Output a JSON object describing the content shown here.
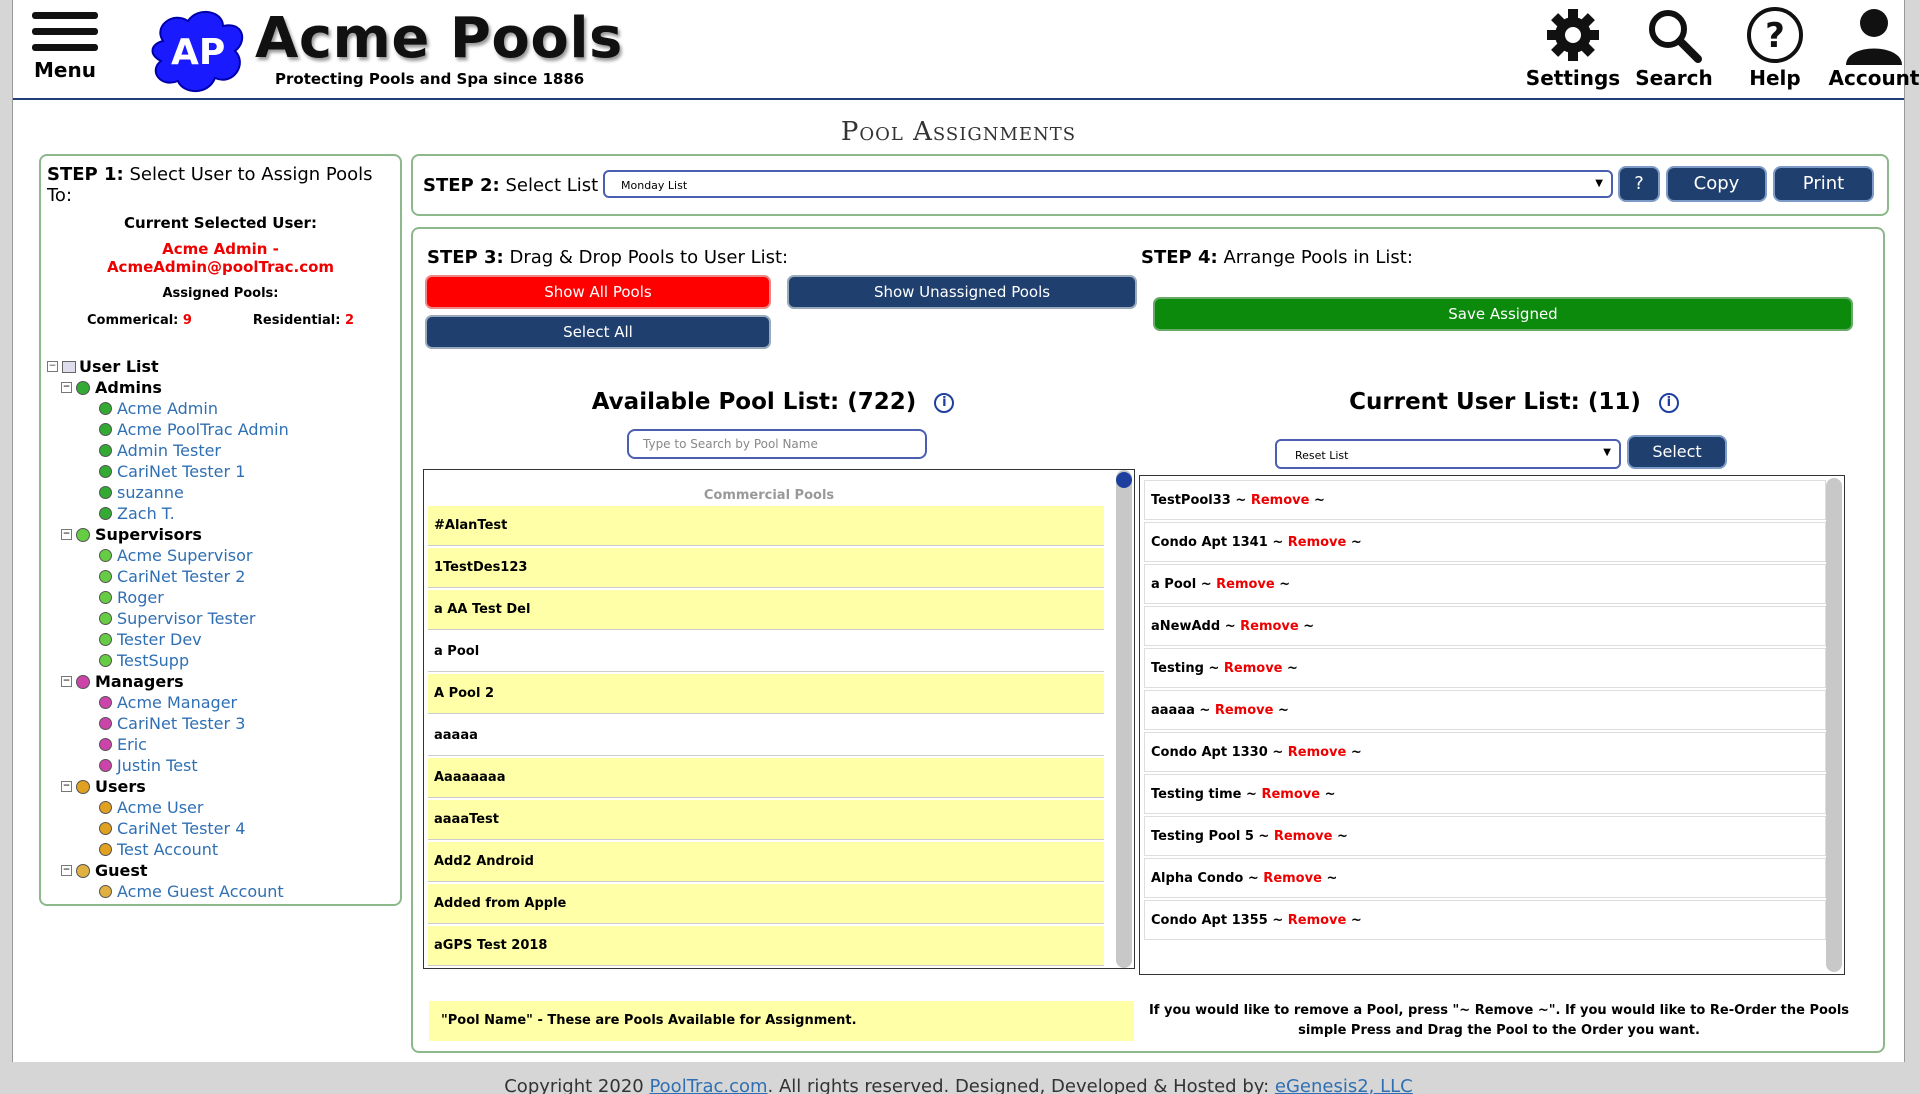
{
  "header": {
    "menu_label": "Menu",
    "logo_initials": "AP",
    "brand": "Acme Pools",
    "tagline": "Protecting Pools and Spa since 1886",
    "settings_label": "Settings",
    "search_label": "Search",
    "help_label": "Help",
    "account_label": "Account"
  },
  "page_title": "Pool Assignments",
  "step1": {
    "step": "STEP 1:",
    "text": "Select User to Assign Pools To:",
    "current_label": "Current Selected User:",
    "current_user": "Acme Admin - AcmeAdmin@poolTrac.com",
    "assigned_label": "Assigned Pools:",
    "commercial_label": "Commerical:",
    "commercial_count": "9",
    "residential_label": "Residential:",
    "residential_count": "2",
    "tree_root": "User List",
    "groups": [
      {
        "name": "Admins",
        "color": "#33aa33",
        "users": [
          "Acme Admin",
          "Acme PoolTrac Admin",
          "Admin Tester",
          "CariNet Tester 1",
          "suzanne",
          "Zach T."
        ]
      },
      {
        "name": "Supervisors",
        "color": "#66cc44",
        "users": [
          "Acme Supervisor",
          "CariNet Tester 2",
          "Roger",
          "Supervisor Tester",
          "Tester Dev",
          "TestSupp"
        ]
      },
      {
        "name": "Managers",
        "color": "#cc44aa",
        "users": [
          "Acme Manager",
          "CariNet Tester 3",
          "Eric",
          "Justin Test"
        ]
      },
      {
        "name": "Users",
        "color": "#e0a020",
        "users": [
          "Acme User",
          "CariNet Tester 4",
          "Test Account"
        ]
      },
      {
        "name": "Guest",
        "color": "#e0b040",
        "users": [
          "Acme Guest Account"
        ]
      }
    ]
  },
  "step2": {
    "step": "STEP 2:",
    "text": "Select List",
    "selected_list": "Monday List",
    "help_btn": "?",
    "copy_btn": "Copy",
    "print_btn": "Print"
  },
  "step3": {
    "step": "STEP 3:",
    "text": "Drag & Drop Pools to User List:",
    "show_all": "Show All Pools",
    "show_unassigned": "Show Unassigned Pools",
    "select_all": "Select All"
  },
  "step4": {
    "step": "STEP 4:",
    "text": "Arrange Pools in List:",
    "save": "Save Assigned"
  },
  "available": {
    "title": "Available Pool List:",
    "count": "(722)",
    "search_placeholder": "Type to Search by Pool Name",
    "category": "Commercial Pools",
    "pools": [
      {
        "name": "#AlanTest",
        "assigned": false
      },
      {
        "name": "1TestDes123",
        "assigned": false
      },
      {
        "name": "a AA Test Del",
        "assigned": false
      },
      {
        "name": "a Pool",
        "assigned": true
      },
      {
        "name": "A Pool 2",
        "assigned": false
      },
      {
        "name": "aaaaa",
        "assigned": true
      },
      {
        "name": "Aaaaaaaa",
        "assigned": false
      },
      {
        "name": "aaaaTest",
        "assigned": false
      },
      {
        "name": "Add2 Android",
        "assigned": false
      },
      {
        "name": "Added from Apple",
        "assigned": false
      },
      {
        "name": "aGPS Test 2018",
        "assigned": false
      }
    ],
    "note": "\"Pool Name\" - These are Pools Available for Assignment."
  },
  "current": {
    "title": "Current User List:",
    "count": "(11)",
    "reset_option": "Reset List",
    "select_btn": "Select",
    "remove_label": "~ Remove ~",
    "pools": [
      "TestPool33",
      "Condo Apt 1341",
      "a Pool",
      "aNewAdd",
      "Testing",
      "aaaaa",
      "Condo Apt 1330",
      "Testing time",
      "Testing Pool 5",
      "Alpha Condo",
      "Condo Apt 1355"
    ],
    "note": "If you would like to remove a Pool, press \"~ Remove ~\". If you would like to Re-Order the Pools simple Press and Drag the Pool to the Order you want."
  },
  "footer": {
    "prefix": "Copyright 2020",
    "link1": "PoolTrac.com",
    "middle": ". All rights reserved. Designed, Developed & Hosted by:",
    "link2": "eGenesis2, LLC"
  },
  "colors": {
    "navy": "#1f3f6f",
    "red": "#ff0000",
    "green": "#0b8a0b",
    "highlight": "#ffffa8",
    "link": "#2f6fb3"
  }
}
